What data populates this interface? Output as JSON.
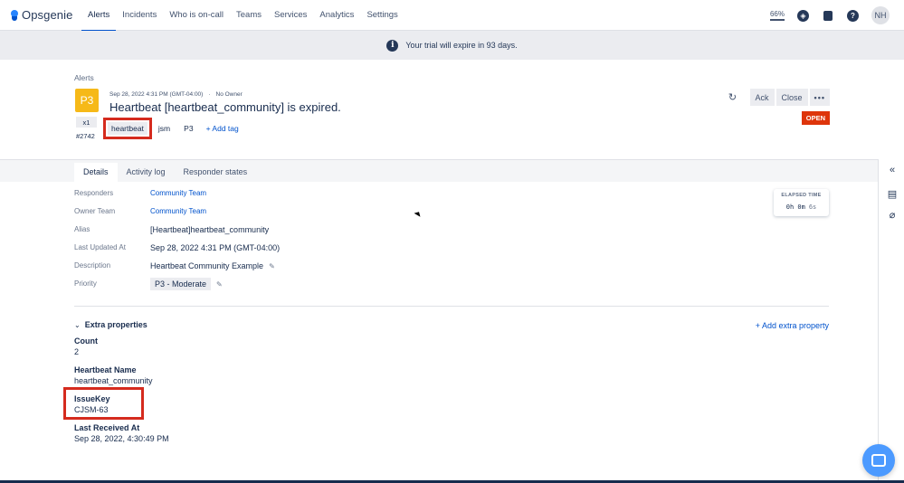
{
  "nav": {
    "brand": "Opsgenie",
    "items": [
      "Alerts",
      "Incidents",
      "Who is on-call",
      "Teams",
      "Services",
      "Analytics",
      "Settings"
    ],
    "active_index": 0,
    "zoom": "66%",
    "avatar": "NH",
    "icons": [
      "compass-icon",
      "notebook-icon",
      "help-icon"
    ]
  },
  "banner": {
    "text": "Your trial will expire in 93 days."
  },
  "alert": {
    "breadcrumb": "Alerts",
    "priority": "P3",
    "count": "x1",
    "tiny_id": "#2742",
    "created": "Sep 28, 2022 4:31 PM (GMT-04:00)",
    "owner": "No Owner",
    "title": "Heartbeat [heartbeat_community] is expired.",
    "tags": [
      "heartbeat",
      "jsm",
      "P3"
    ],
    "add_tag": "+ Add tag",
    "status": "OPEN",
    "actions": {
      "ack": "Ack",
      "close": "Close",
      "more": "•••"
    }
  },
  "tabs": [
    "Details",
    "Activity log",
    "Responder states"
  ],
  "details": [
    {
      "label": "Responders",
      "value": "Community Team",
      "link": true
    },
    {
      "label": "Owner Team",
      "value": "Community Team",
      "link": true
    },
    {
      "label": "Alias",
      "value": "[Heartbeat]heartbeat_community"
    },
    {
      "label": "Last Updated At",
      "value": "Sep 28, 2022 4:31 PM (GMT-04:00)"
    },
    {
      "label": "Description",
      "value": "Heartbeat Community Example",
      "editable": true
    },
    {
      "label": "Priority",
      "value": "P3 - Moderate",
      "editable": true
    }
  ],
  "elapsed": {
    "label": "ELAPSED TIME",
    "hm": "0h 0m",
    "s": "6s"
  },
  "extra": {
    "heading": "Extra properties",
    "add": "+ Add extra property",
    "props": [
      {
        "key": "Count",
        "value": "2"
      },
      {
        "key": "Heartbeat Name",
        "value": "heartbeat_community"
      },
      {
        "key": "IssueKey",
        "value": "CJSM-63"
      },
      {
        "key": "Last Received At",
        "value": "Sep 28, 2022, 4:30:49 PM"
      }
    ]
  }
}
